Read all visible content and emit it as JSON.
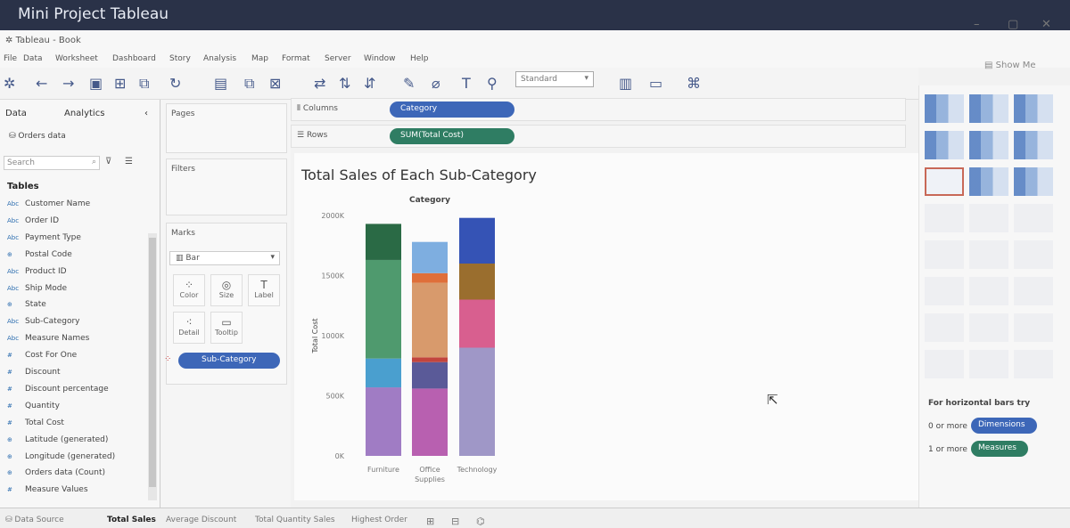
{
  "overlay_title": "Mini Project Tableau",
  "window": {
    "title": "Tableau - Book"
  },
  "menu": [
    "File",
    "Data",
    "Worksheet",
    "Dashboard",
    "Story",
    "Analysis",
    "Map",
    "Format",
    "Server",
    "Window",
    "Help"
  ],
  "toolbar": {
    "fit_dropdown": "Standard",
    "show_me": "Show Me"
  },
  "data_pane": {
    "tab_data": "Data",
    "tab_analytics": "Analytics",
    "datasource": "Orders data",
    "search_placeholder": "Search",
    "tables_heading": "Tables",
    "fields": [
      {
        "icon": "Abc",
        "name": "Customer Name"
      },
      {
        "icon": "Abc",
        "name": "Order ID"
      },
      {
        "icon": "Abc",
        "name": "Payment Type"
      },
      {
        "icon": "⊕",
        "name": "Postal Code"
      },
      {
        "icon": "Abc",
        "name": "Product ID"
      },
      {
        "icon": "Abc",
        "name": "Ship Mode"
      },
      {
        "icon": "⊕",
        "name": "State"
      },
      {
        "icon": "Abc",
        "name": "Sub-Category"
      },
      {
        "icon": "Abc",
        "name": "Measure Names"
      },
      {
        "icon": "#",
        "name": "Cost For One"
      },
      {
        "icon": "#",
        "name": "Discount"
      },
      {
        "icon": "#",
        "name": "Discount percentage"
      },
      {
        "icon": "#",
        "name": "Quantity"
      },
      {
        "icon": "#",
        "name": "Total Cost"
      },
      {
        "icon": "⊕",
        "name": "Latitude (generated)"
      },
      {
        "icon": "⊕",
        "name": "Longitude (generated)"
      },
      {
        "icon": "⊕",
        "name": "Orders data (Count)"
      },
      {
        "icon": "#",
        "name": "Measure Values"
      }
    ]
  },
  "cards": {
    "pages": "Pages",
    "filters": "Filters",
    "marks": "Marks",
    "mark_type": "Bar",
    "color": "Color",
    "size": "Size",
    "label": "Label",
    "detail": "Detail",
    "tooltip": "Tooltip",
    "color_pill": "Sub-Category"
  },
  "shelves": {
    "columns_label": "Columns",
    "columns_pill": "Category",
    "rows_label": "Rows",
    "rows_pill": "SUM(Total Cost)"
  },
  "show_me": {
    "hint": "For horizontal bars try",
    "line1_prefix": "0 or more",
    "dimensions": "Dimensions",
    "line2_prefix": "1 or more",
    "measures": "Measures"
  },
  "sheet_tabs": [
    "Data Source",
    "Total Sales",
    "Average Discount",
    "Total Quantity Sales",
    "Highest Order"
  ],
  "colors": {
    "pill_blue": "#3d67b8",
    "pill_green": "#2f7d63"
  },
  "chart_data": {
    "type": "bar",
    "stacked": true,
    "title": "Total Sales of Each Sub-Category",
    "legend_header": "Category",
    "ylabel": "Total Cost",
    "ylim": [
      0,
      2000000
    ],
    "yticks": [
      0,
      500000,
      1000000,
      1500000,
      2000000
    ],
    "ytick_labels": [
      "0K",
      "500K",
      "1000K",
      "1500K",
      "2000K"
    ],
    "categories": [
      "Furniture",
      "Office Supplies",
      "Technology"
    ],
    "category_labels": [
      "Furniture",
      "Office\nSupplies",
      "Technology"
    ],
    "series": [
      {
        "category": "Furniture",
        "segments": [
          {
            "value": 570000,
            "color": "#a07cc4"
          },
          {
            "value": 240000,
            "color": "#4a9fcf"
          },
          {
            "value": 820000,
            "color": "#4f9a6e"
          },
          {
            "value": 300000,
            "color": "#2a6a45"
          }
        ]
      },
      {
        "category": "Office Supplies",
        "segments": [
          {
            "value": 560000,
            "color": "#b860b0"
          },
          {
            "value": 220000,
            "color": "#5a5a98"
          },
          {
            "value": 40000,
            "color": "#c2453d"
          },
          {
            "value": 620000,
            "color": "#d89a6c"
          },
          {
            "value": 80000,
            "color": "#df6f3a"
          },
          {
            "value": 260000,
            "color": "#7eaee0"
          }
        ]
      },
      {
        "category": "Technology",
        "segments": [
          {
            "value": 900000,
            "color": "#9f97c7"
          },
          {
            "value": 400000,
            "color": "#d85f8f"
          },
          {
            "value": 300000,
            "color": "#9a6e2e"
          },
          {
            "value": 380000,
            "color": "#3553b5"
          }
        ]
      }
    ]
  }
}
